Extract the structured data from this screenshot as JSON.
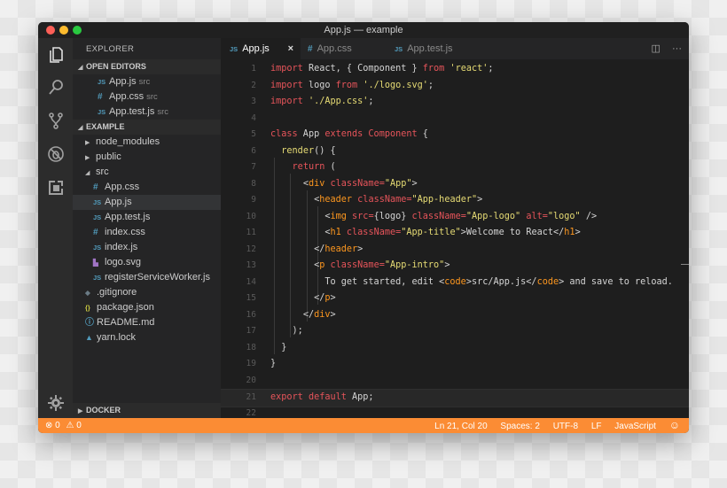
{
  "window": {
    "title": "App.js — example"
  },
  "activity_bar": {
    "icons": [
      "files-icon",
      "search-icon",
      "source-control-icon",
      "debug-icon",
      "extensions-icon",
      "gear-icon"
    ]
  },
  "sidebar": {
    "title": "EXPLORER",
    "open_editors": {
      "label": "OPEN EDITORS",
      "items": [
        {
          "icon": "JS",
          "name": "App.js",
          "path": "src"
        },
        {
          "icon": "#",
          "name": "App.css",
          "path": "src"
        },
        {
          "icon": "JS",
          "name": "App.test.js",
          "path": "src"
        }
      ]
    },
    "project": {
      "label": "EXAMPLE",
      "folders": [
        {
          "name": "node_modules",
          "expanded": false
        },
        {
          "name": "public",
          "expanded": false
        },
        {
          "name": "src",
          "expanded": true
        }
      ],
      "src_files": [
        {
          "icon": "#",
          "name": "App.css"
        },
        {
          "icon": "JS",
          "name": "App.js",
          "active": true
        },
        {
          "icon": "JS",
          "name": "App.test.js"
        },
        {
          "icon": "#",
          "name": "index.css"
        },
        {
          "icon": "JS",
          "name": "index.js"
        },
        {
          "icon": "svg",
          "name": "logo.svg"
        },
        {
          "icon": "JS",
          "name": "registerServiceWorker.js"
        }
      ],
      "root_files": [
        {
          "icon": "git",
          "name": ".gitignore"
        },
        {
          "icon": "{}",
          "name": "package.json"
        },
        {
          "icon": "i",
          "name": "README.md"
        },
        {
          "icon": "yarn",
          "name": "yarn.lock"
        }
      ]
    },
    "docker": {
      "label": "DOCKER"
    }
  },
  "tabs": [
    {
      "icon": "JS",
      "label": "App.js",
      "active": true,
      "close": "×"
    },
    {
      "icon": "#",
      "label": "App.css"
    },
    {
      "icon": "JS",
      "label": "App.test.js"
    }
  ],
  "tab_actions": {
    "split": "◫",
    "more": "···"
  },
  "code": {
    "current_line": 21,
    "lines": [
      "import React, { Component } from 'react';",
      "import logo from './logo.svg';",
      "import './App.css';",
      "",
      "class App extends Component {",
      "  render() {",
      "    return (",
      "      <div className=\"App\">",
      "        <header className=\"App-header\">",
      "          <img src={logo} className=\"App-logo\" alt=\"logo\" />",
      "          <h1 className=\"App-title\">Welcome to React</h1>",
      "        </header>",
      "        <p className=\"App-intro\">",
      "          To get started, edit <code>src/App.js</code> and save to reload.",
      "        </p>",
      "      </div>",
      "    );",
      "  }",
      "}",
      "",
      "export default App;",
      ""
    ]
  },
  "statusbar": {
    "errors": "0",
    "warnings": "0",
    "position": "Ln 21, Col 20",
    "spaces": "Spaces: 2",
    "encoding": "UTF-8",
    "eol": "LF",
    "language": "JavaScript",
    "feedback": "☺"
  },
  "colors": {
    "statusbar": "#fb8c34",
    "keyword": "#f92672",
    "string": "#e6db74",
    "tag": "#fd971f"
  }
}
